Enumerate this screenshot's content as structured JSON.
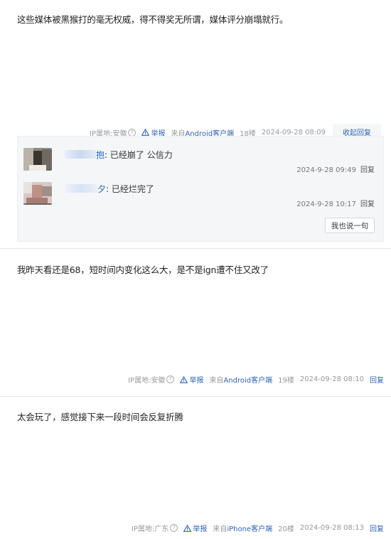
{
  "posts": [
    {
      "content": "这些媒体被黑猴打的毫无权威，得不得奖无所谓，媒体评分崩塌就行。",
      "ip": "IP属地:安徽",
      "report": "举报",
      "client_prefix": "来自",
      "client": "Android客户端",
      "floor": "18楼",
      "time": "2024-09-28 08:09",
      "action": "收起回复",
      "replies": [
        {
          "user_suffix": "抱",
          "content": ": 已经崩了 公信力",
          "time": "2024-9-28 09:49",
          "reply": "回复"
        },
        {
          "user_suffix": "夕",
          "content": ": 已经烂完了",
          "time": "2024-9-28 10:17",
          "reply": "回复"
        }
      ],
      "say_button": "我也说一句"
    },
    {
      "content": "我昨天看还是68，短时间内变化这么大，是不是ign遭不住又改了",
      "ip": "IP属地:安徽",
      "report": "举报",
      "client_prefix": "来自",
      "client": "Android客户端",
      "floor": "19楼",
      "time": "2024-09-28 08:10",
      "action": "回复"
    },
    {
      "content": "太会玩了，感觉接下来一段时间会反复折腾",
      "ip": "IP属地:广东",
      "report": "举报",
      "client_prefix": "来自",
      "client": "iPhone客户端",
      "floor": "20楼",
      "time": "2024-09-28 08:13",
      "action": "回复"
    }
  ],
  "colors": {
    "link": "#2d64b3",
    "muted": "#999999",
    "panel": "#f5f6f8"
  },
  "icons": {
    "help": "help-circle-icon",
    "report": "warning-triangle-icon"
  }
}
